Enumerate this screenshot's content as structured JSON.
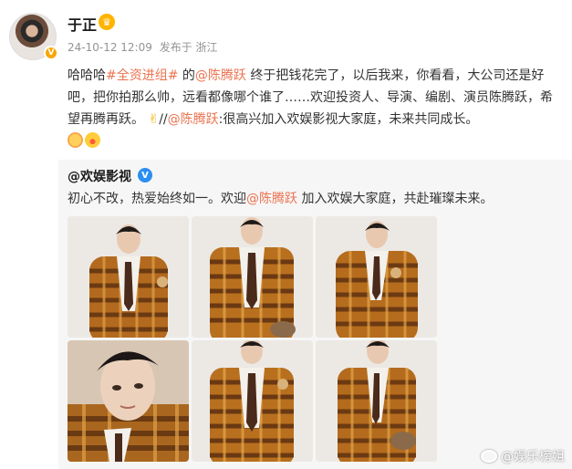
{
  "author": {
    "name": "于正",
    "time": "24-10-12 12:09",
    "source": "发布于 浙江",
    "verified_badge": "V"
  },
  "post": {
    "t1": "哈哈哈",
    "hashtag": "#全资进组#",
    "t2": " 的",
    "mention1": "@陈腾跃",
    "t3": " 终于把钱花完了，以后我来，你看看，大公司还是好吧，把你拍那么帅，远看都像哪个谁了……欢迎投资人、导演、编剧、演员陈腾跃，希望再腾再跃。",
    "t4": "//",
    "mention2": "@陈腾跃",
    "t5": ":很高兴加入欢娱影视大家庭，未来共同成长。"
  },
  "repost": {
    "user": "@欢娱影视",
    "t1": "初心不改，热爱始终如一。欢迎",
    "mention": "@陈腾跃",
    "t2": " 加入欢娱大家庭，共赴璀璨未来。"
  },
  "photos": [
    "photo-1",
    "photo-2",
    "photo-3",
    "photo-4",
    "photo-5",
    "photo-6"
  ],
  "watermark": "@娱乐榜姐",
  "icons": [
    "crown-icon",
    "verified-icon",
    "emoji-icon",
    "hand-icon",
    "weibo-logo-icon"
  ],
  "colors": {
    "link": "#eb7350",
    "meta": "#939393",
    "verified_blue": "#2a8ef2",
    "verified_gold": "#f7a600"
  }
}
